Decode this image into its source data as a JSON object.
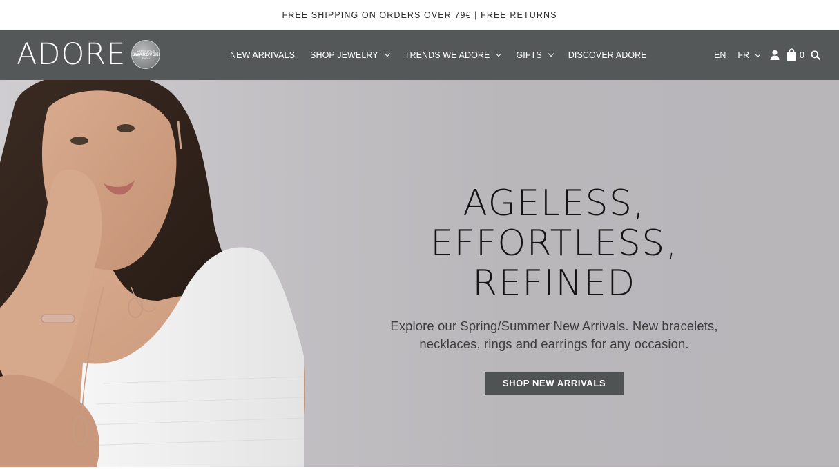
{
  "announcement": "FREE SHIPPING ON ORDERS OVER 79€ | FREE RETURNS",
  "header": {
    "logo_text": "ADORE",
    "seal": {
      "line1": "CRYSTALS",
      "line2": "SWAROVSKI",
      "line3": "FROM"
    },
    "nav": [
      {
        "label": "NEW ARRIVALS"
      },
      {
        "label": "SHOP JEWELRY"
      },
      {
        "label": "TRENDS WE ADORE"
      },
      {
        "label": "GIFTS"
      },
      {
        "label": "DISCOVER ADORE"
      }
    ],
    "languages": {
      "current": "EN",
      "other": "FR"
    },
    "cart_count": "0",
    "icons": [
      "account-icon",
      "shopping-bag-icon",
      "search-icon"
    ]
  },
  "hero": {
    "headline_line1": "AGELESS, EFFORTLESS,",
    "headline_line2": "REFINED",
    "sub_line1": "Explore our Spring/Summer New Arrivals. New bracelets,",
    "sub_line2": "necklaces, rings and earrings for any occasion.",
    "cta_label": "SHOP NEW ARRIVALS"
  },
  "colors": {
    "nav_background": "#545859",
    "hero_background": "#b9b7ba",
    "cta_background": "#4f5354"
  }
}
